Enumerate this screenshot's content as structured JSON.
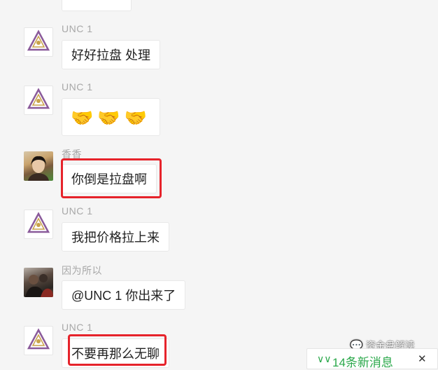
{
  "messages": [
    {
      "sender": "",
      "text": ""
    },
    {
      "sender": "UNC  1",
      "text": "好好拉盘  处理"
    },
    {
      "sender": "UNC  1",
      "text": "🤝🤝🤝"
    },
    {
      "sender": "香香",
      "text": "你倒是拉盘啊"
    },
    {
      "sender": "UNC  1",
      "text": "我把价格拉上来"
    },
    {
      "sender": "因为所以",
      "text": "@UNC  1 你出来了"
    },
    {
      "sender": "UNC  1",
      "text": "不要再那么无聊"
    }
  ],
  "new_messages": {
    "label": "14条新消息",
    "icon": "double-chevron-down-icon",
    "close_icon": "close-icon"
  },
  "watermark": {
    "text": "资金盘解读",
    "icon": "wechat-icon"
  },
  "colors": {
    "highlight": "#e6232b",
    "toast_green": "#2aa84a",
    "background": "#f5f5f5"
  }
}
